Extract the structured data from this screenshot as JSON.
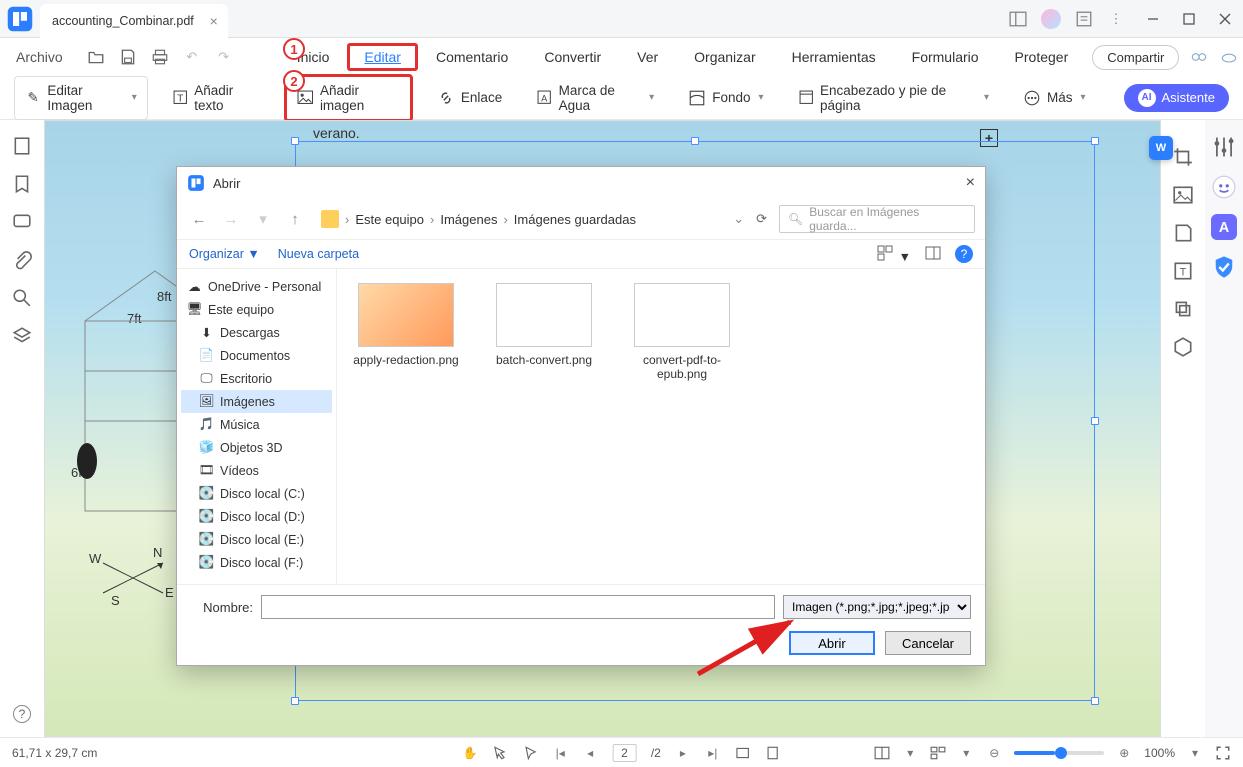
{
  "titlebar": {
    "tab_name": "accounting_Combinar.pdf"
  },
  "menu": {
    "archivo": "Archivo",
    "items": [
      "Inicio",
      "Editar",
      "Comentario",
      "Convertir",
      "Ver",
      "Organizar",
      "Herramientas",
      "Formulario",
      "Proteger"
    ],
    "active_index": 1,
    "compartir": "Compartir"
  },
  "toolbar": {
    "editar_imagen": "Editar Imagen",
    "anadir_texto": "Añadir texto",
    "anadir_imagen": "Añadir imagen",
    "enlace": "Enlace",
    "marca_agua": "Marca de Agua",
    "fondo": "Fondo",
    "encabezado": "Encabezado y pie de página",
    "mas": "Más",
    "asistente": "Asistente",
    "ai_badge": "AI"
  },
  "callouts": {
    "c1": "1",
    "c2": "2"
  },
  "canvas": {
    "verano": "verano.",
    "d8ft": "8ft",
    "d7ft": "7ft",
    "d6ft": "6ft",
    "w": "W",
    "e": "E",
    "s": "S",
    "n": "N"
  },
  "dialog": {
    "title": "Abrir",
    "breadcrumb": [
      "Este equipo",
      "Imágenes",
      "Imágenes guardadas"
    ],
    "search_placeholder": "Buscar en Imágenes guarda...",
    "organizar": "Organizar",
    "nueva_carpeta": "Nueva carpeta",
    "tree": [
      {
        "label": "OneDrive - Personal",
        "icon": "cloud",
        "indent": 0
      },
      {
        "label": "Este equipo",
        "icon": "pc",
        "indent": 0
      },
      {
        "label": "Descargas",
        "icon": "download",
        "indent": 1
      },
      {
        "label": "Documentos",
        "icon": "doc",
        "indent": 1
      },
      {
        "label": "Escritorio",
        "icon": "desktop",
        "indent": 1
      },
      {
        "label": "Imágenes",
        "icon": "img",
        "indent": 1,
        "selected": true
      },
      {
        "label": "Música",
        "icon": "music",
        "indent": 1
      },
      {
        "label": "Objetos 3D",
        "icon": "3d",
        "indent": 1
      },
      {
        "label": "Vídeos",
        "icon": "video",
        "indent": 1
      },
      {
        "label": "Disco local (C:)",
        "icon": "disk",
        "indent": 1
      },
      {
        "label": "Disco local (D:)",
        "icon": "disk",
        "indent": 1
      },
      {
        "label": "Disco local (E:)",
        "icon": "disk",
        "indent": 1
      },
      {
        "label": "Disco local (F:)",
        "icon": "disk",
        "indent": 1
      }
    ],
    "files": [
      {
        "name": "apply-redaction.png"
      },
      {
        "name": "batch-convert.png"
      },
      {
        "name": "convert-pdf-to-epub.png"
      }
    ],
    "nombre_label": "Nombre:",
    "nombre_value": "",
    "filter": "Imagen (*.png;*.jpg;*.jpeg;*.jpe",
    "btn_open": "Abrir",
    "btn_cancel": "Cancelar"
  },
  "statusbar": {
    "dims": "61,71 x 29,7 cm",
    "page_current": "2",
    "page_total": "/2",
    "zoom": "100%"
  },
  "colors": {
    "accent": "#2b7fff",
    "callout": "#e03030"
  }
}
